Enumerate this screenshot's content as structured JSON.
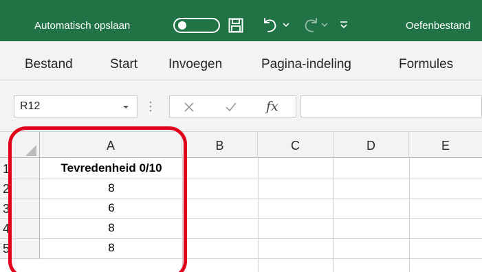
{
  "title_bar": {
    "autosave_label": "Automatisch opslaan",
    "filename": "Oefenbestand",
    "background": "#217346",
    "icons": [
      "toggle-switch",
      "save-icon",
      "undo-icon",
      "redo-icon",
      "customize-toolbar-icon"
    ]
  },
  "ribbon_tabs": [
    "Bestand",
    "Start",
    "Invoegen",
    "Pagina-indeling",
    "Formules"
  ],
  "formula_bar": {
    "name_box_value": "R12",
    "fx_label": "fx",
    "formula_value": ""
  },
  "grid": {
    "column_headers": [
      "A",
      "B",
      "C",
      "D",
      "E"
    ],
    "row_headers": [
      "1",
      "2",
      "3",
      "4",
      "5"
    ],
    "column_a_values": [
      "Tevredenheid 0/10",
      "8",
      "6",
      "8",
      "8"
    ]
  },
  "highlight_color": "#e0001b"
}
